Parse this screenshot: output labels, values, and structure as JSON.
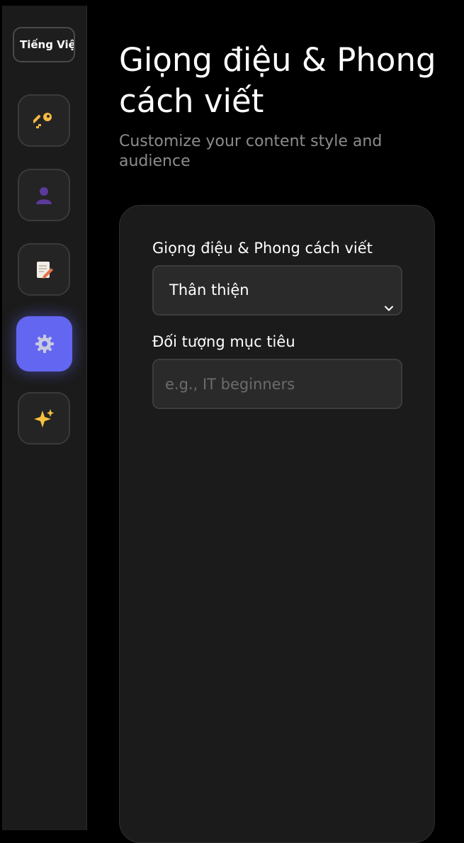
{
  "sidebar": {
    "language_button": "Tiếng Việt",
    "items": [
      {
        "icon": "key-icon",
        "glyph": "🔑"
      },
      {
        "icon": "user-icon",
        "glyph": "👤"
      },
      {
        "icon": "memo-icon",
        "glyph": "📝"
      },
      {
        "icon": "gear-icon",
        "glyph": "⚙",
        "active": true
      },
      {
        "icon": "sparkles-icon",
        "glyph": "✨"
      }
    ]
  },
  "header": {
    "title": "Giọng điệu & Phong cách viết",
    "subtitle": "Customize your content style and audience"
  },
  "form": {
    "tone_label": "Giọng điệu & Phong cách viết",
    "tone_value": "Thân thiện",
    "audience_label": "Đối tượng mục tiêu",
    "audience_placeholder": "e.g., IT beginners",
    "audience_value": ""
  },
  "colors": {
    "accent": "#6366f1",
    "background": "#000000",
    "panel": "#1b1b1b"
  }
}
